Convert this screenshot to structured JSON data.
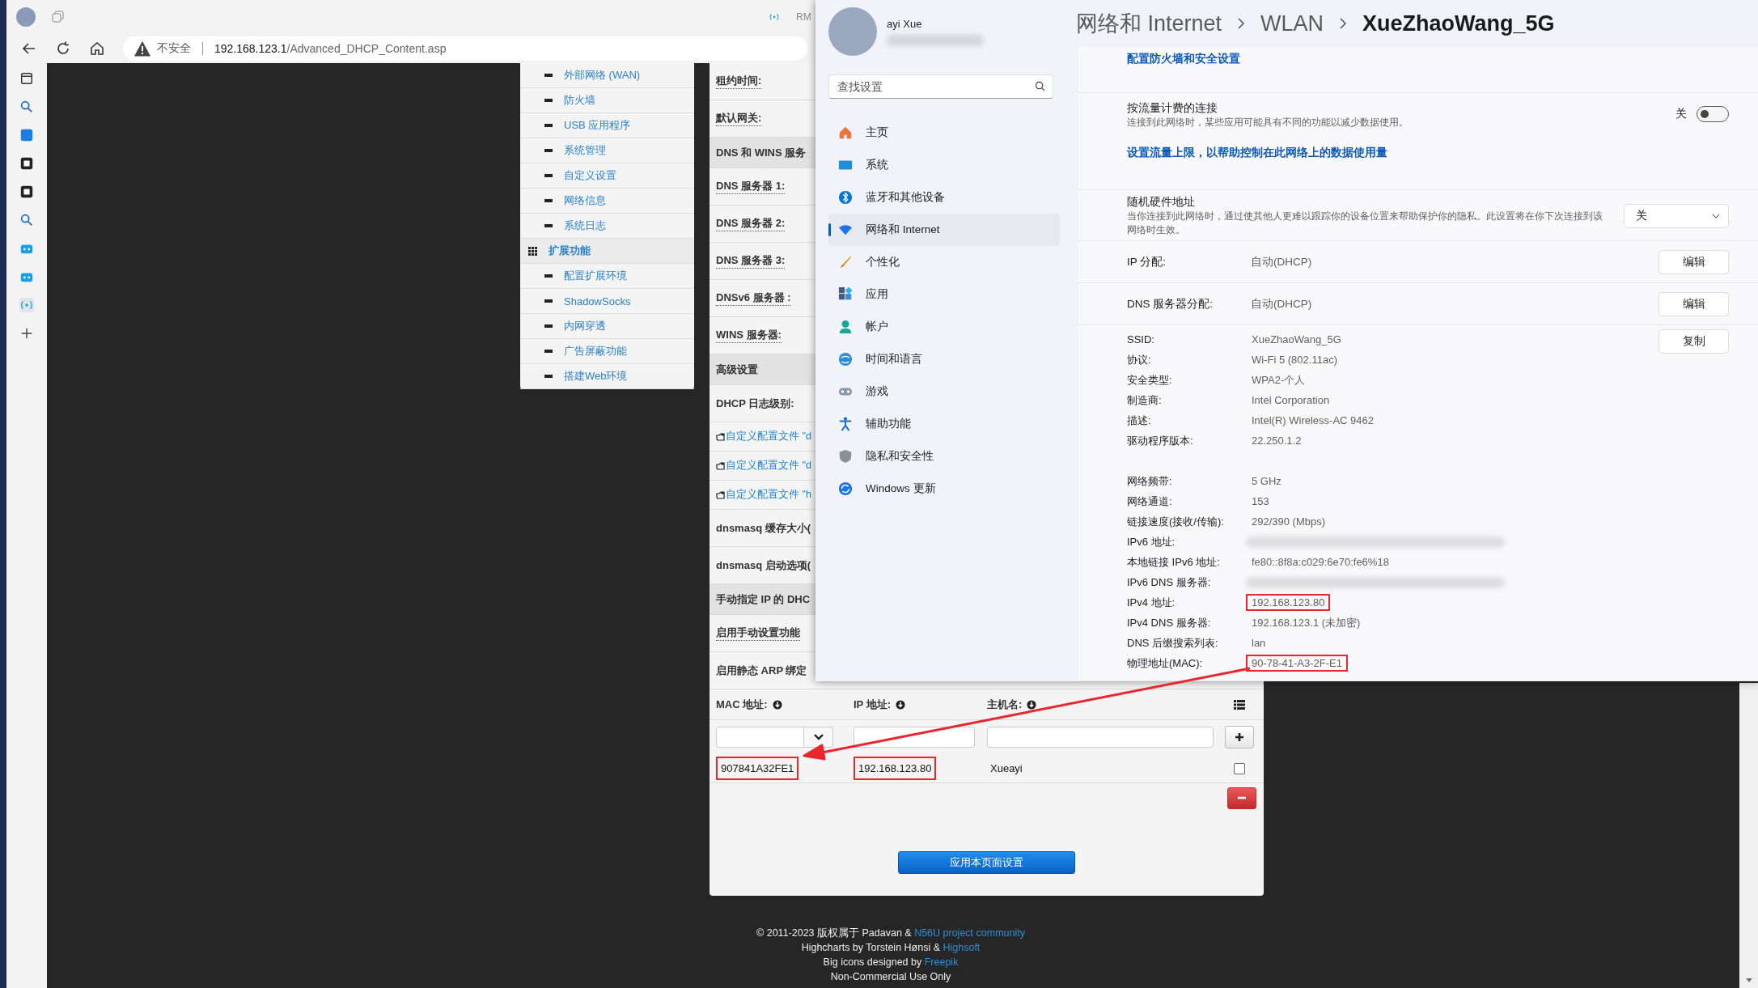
{
  "browser": {
    "title_bar": {
      "text": "RM"
    },
    "address_bar": {
      "security": "不安全",
      "url_host": "192.168.123.1",
      "url_path": "/Advanced_DHCP_Content.asp"
    }
  },
  "router": {
    "nav": [
      {
        "kind": "item",
        "label": "外部网络 (WAN)"
      },
      {
        "kind": "item",
        "label": "防火墙"
      },
      {
        "kind": "item",
        "label": "USB 应用程序"
      },
      {
        "kind": "item",
        "label": "系统管理"
      },
      {
        "kind": "item",
        "label": "自定义设置"
      },
      {
        "kind": "item",
        "label": "网络信息"
      },
      {
        "kind": "item",
        "label": "系统日志"
      },
      {
        "kind": "header",
        "label": "扩展功能"
      },
      {
        "kind": "item",
        "label": "配置扩展环境"
      },
      {
        "kind": "item",
        "label": "ShadowSocks"
      },
      {
        "kind": "item",
        "label": "内网穿透"
      },
      {
        "kind": "item",
        "label": "广告屏蔽功能"
      },
      {
        "kind": "item",
        "label": "搭建Web环境"
      }
    ],
    "form_rows": [
      {
        "kind": "field",
        "label": "租约时间:",
        "hint": true
      },
      {
        "kind": "field",
        "label": "默认网关:",
        "hint": true
      },
      {
        "kind": "header",
        "label": "DNS 和 WINS 服务"
      },
      {
        "kind": "field",
        "label": "DNS 服务器 1:",
        "hint": true
      },
      {
        "kind": "field",
        "label": "DNS 服务器 2:",
        "hint": true
      },
      {
        "kind": "field",
        "label": "DNS 服务器 3:",
        "hint": true
      },
      {
        "kind": "field",
        "label": "DNSv6 服务器 :",
        "hint": true
      },
      {
        "kind": "field",
        "label": "WINS 服务器:",
        "hint": true
      },
      {
        "kind": "header",
        "label": "高级设置"
      },
      {
        "kind": "field",
        "label": "DHCP 日志级别:",
        "hint": false
      },
      {
        "kind": "link",
        "label": "自定义配置文件 \"d"
      },
      {
        "kind": "link",
        "label": "自定义配置文件 \"d"
      },
      {
        "kind": "link",
        "label": "自定义配置文件 \"h"
      },
      {
        "kind": "field",
        "label": "dnsmasq 缓存大小(",
        "hint": false
      },
      {
        "kind": "field",
        "label": "dnsmasq 启动选项(",
        "hint": false
      },
      {
        "kind": "header",
        "label": "手动指定 IP 的 DHC"
      },
      {
        "kind": "field",
        "label": "启用手动设置功能",
        "hint": true
      },
      {
        "kind": "field",
        "label": "启用静态 ARP 绑定",
        "hint": false
      }
    ],
    "table": {
      "columns": [
        "MAC 地址:",
        "IP 地址:",
        "主机名:"
      ],
      "rows": [
        {
          "cells": [
            {
              "text": "907841A32FE1",
              "highlighted": true
            },
            {
              "text": "192.168.123.80",
              "highlighted": true
            },
            {
              "text": "Xueayi",
              "highlighted": false
            }
          ],
          "checked": false
        }
      ]
    },
    "apply_button": "应用本页面设置",
    "footer": [
      {
        "text": "© 2011-2023 版权属于 Padavan & ",
        "link": "N56U project community"
      },
      {
        "text": "Highcharts by Torstein Hønsi & ",
        "link": "Highsoft"
      },
      {
        "text": "Big icons designed by ",
        "link": "Freepik"
      },
      {
        "text": "Non-Commercial Use Only"
      }
    ]
  },
  "settings": {
    "user": {
      "name": "ayi Xue"
    },
    "search": {
      "placeholder": "查找设置"
    },
    "nav": [
      {
        "label": "主页",
        "selected": false
      },
      {
        "label": "系统",
        "selected": false
      },
      {
        "label": "蓝牙和其他设备",
        "selected": false
      },
      {
        "label": "网络和 Internet",
        "selected": true
      },
      {
        "label": "个性化",
        "selected": false
      },
      {
        "label": "应用",
        "selected": false
      },
      {
        "label": "帐户",
        "selected": false
      },
      {
        "label": "时间和语言",
        "selected": false
      },
      {
        "label": "游戏",
        "selected": false
      },
      {
        "label": "辅助功能",
        "selected": false
      },
      {
        "label": "隐私和安全性",
        "selected": false
      },
      {
        "label": "Windows 更新",
        "selected": false
      }
    ],
    "breadcrumb": [
      "网络和 Internet",
      "WLAN",
      "XueZhaoWang_5G"
    ],
    "firewall_link": "配置防火墙和安全设置",
    "metered": {
      "title": "按流量计费的连接",
      "description": "连接到此网络时，某些应用可能具有不同的功能以减少数据使用。",
      "toggle": {
        "label": "关",
        "on": false
      },
      "link": "设置流量上限，以帮助控制在此网络上的数据使用量"
    },
    "random_mac": {
      "title": "随机硬件地址",
      "description": "当你连接到此网络时，通过使其他人更难以跟踪你的设备位置来帮助保护你的隐私。此设置将在你下次连接到该网络时生效。",
      "dropdown": "关"
    },
    "assignments": [
      {
        "label": "IP 分配:",
        "value": "自动(DHCP)",
        "button": "编辑"
      },
      {
        "label": "DNS 服务器分配:",
        "value": "自动(DHCP)",
        "button": "编辑"
      }
    ],
    "copy_button": "复制",
    "property_groups": [
      [
        {
          "label": "SSID:",
          "value": "XueZhaoWang_5G"
        },
        {
          "label": "协议:",
          "value": "Wi-Fi 5 (802.11ac)"
        },
        {
          "label": "安全类型:",
          "value": "WPA2-个人"
        },
        {
          "label": "制造商:",
          "value": "Intel Corporation"
        },
        {
          "label": "描述:",
          "value": "Intel(R) Wireless-AC 9462"
        },
        {
          "label": "驱动程序版本:",
          "value": "22.250.1.2"
        }
      ],
      [
        {
          "label": "网络频带:",
          "value": "5 GHz"
        },
        {
          "label": "网络通道:",
          "value": "153"
        },
        {
          "label": "链接速度(接收/传输):",
          "value": "292/390 (Mbps)"
        },
        {
          "label": "IPv6 地址:",
          "redacted": true
        },
        {
          "label": "本地链接 IPv6 地址:",
          "value": "fe80::8f8a:c029:6e70:fe6%18"
        },
        {
          "label": "IPv6 DNS 服务器:",
          "redacted": true
        },
        {
          "label": "IPv4 地址:",
          "value": "192.168.123.80",
          "highlighted": true
        },
        {
          "label": "IPv4 DNS 服务器:",
          "value": "192.168.123.1 (未加密)"
        },
        {
          "label": "DNS 后缀搜索列表:",
          "value": "lan"
        },
        {
          "label": "物理地址(MAC):",
          "value": "90-78-41-A3-2F-E1",
          "highlighted": true
        }
      ]
    ]
  }
}
